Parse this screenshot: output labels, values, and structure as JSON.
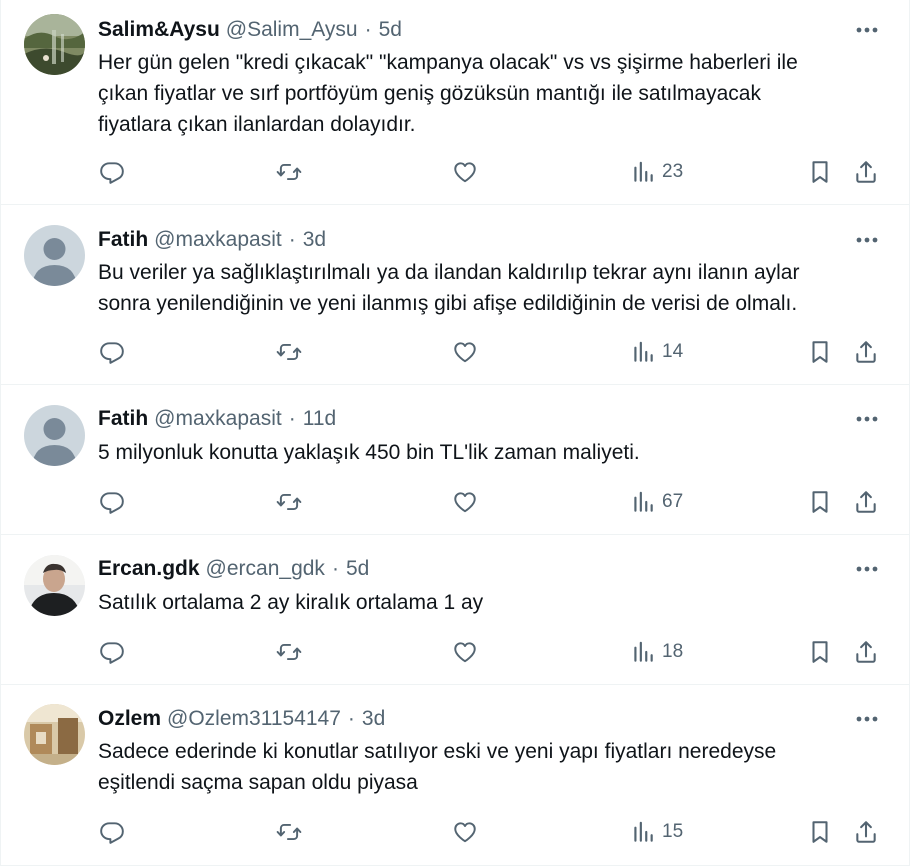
{
  "colors": {
    "text": "#0f1419",
    "secondary": "#536471",
    "divider": "#eff3f4"
  },
  "icons": {
    "more": "more-horizontal-icon",
    "reply": "reply-icon",
    "retweet": "retweet-icon",
    "like": "like-icon",
    "views": "views-icon",
    "bookmark": "bookmark-icon",
    "share": "share-icon"
  },
  "tweets": [
    {
      "name": "Salim&Aysu",
      "handle": "@Salim_Aysu",
      "separator": "·",
      "time": "5d",
      "text": "Her gün gelen \"kredi çıkacak\" \"kampanya olacak\" vs vs şişirme haberleri ile\nçıkan fiyatlar ve sırf portföyüm geniş gözüksün mantığı ile satılmayacak\nfiyatlara çıkan ilanlardan dolayıdır.",
      "views": "23"
    },
    {
      "name": "Fatih",
      "handle": "@maxkapasit",
      "separator": "·",
      "time": "3d",
      "text": "Bu veriler ya sağlıklaştırılmalı ya da ilandan kaldırılıp tekrar aynı ilanın aylar\nsonra yenilendiğinin ve yeni ilanmış gibi afişe edildiğinin de verisi de olmalı.",
      "views": "14"
    },
    {
      "name": "Fatih",
      "handle": "@maxkapasit",
      "separator": "·",
      "time": "11d",
      "text": "5 milyonluk konutta yaklaşık 450 bin TL'lik zaman maliyeti.",
      "views": "67"
    },
    {
      "name": "Ercan.gdk",
      "handle": "@ercan_gdk",
      "separator": "·",
      "time": "5d",
      "text": "Satılık ortalama 2 ay kiralık ortalama 1 ay",
      "views": "18"
    },
    {
      "name": "Ozlem",
      "handle": "@Ozlem31154147",
      "separator": "·",
      "time": "3d",
      "text": "Sadece ederinde ki konutlar satılıyor eski ve yeni yapı fiyatları neredeyse\neşitlendi saçma sapan oldu piyasa",
      "views": "15"
    }
  ]
}
